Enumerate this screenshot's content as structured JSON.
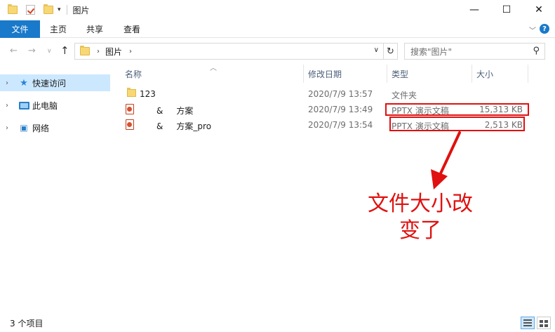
{
  "window": {
    "title": "图片",
    "controls": {
      "minimize": "—",
      "maximize": "☐",
      "close": "✕"
    }
  },
  "ribbon": {
    "tabs": [
      "文件",
      "主页",
      "共享",
      "查看"
    ],
    "help": "?"
  },
  "navigation": {
    "breadcrumb": [
      "图片"
    ],
    "search_placeholder": "搜索\"图片\""
  },
  "sidebar": {
    "items": [
      {
        "label": "快速访问",
        "icon": "star-icon",
        "selected": true
      },
      {
        "label": "此电脑",
        "icon": "computer-icon",
        "selected": false
      },
      {
        "label": "网络",
        "icon": "network-icon",
        "selected": false
      }
    ]
  },
  "columns": [
    "名称",
    "修改日期",
    "类型",
    "大小"
  ],
  "files": [
    {
      "name": "123",
      "modified": "2020/7/9 13:57",
      "type": "文件夹",
      "size": "",
      "icon": "folder-icon"
    },
    {
      "name": "&     方案",
      "modified": "2020/7/9 13:49",
      "type": "PPTX 演示文稿",
      "size": "15,313 KB",
      "icon": "pptx-icon"
    },
    {
      "name": "&     方案_pro",
      "modified": "2020/7/9 13:54",
      "type": "PPTX 演示文稿",
      "size": "2,513 KB",
      "icon": "pptx-icon"
    }
  ],
  "annotation": {
    "line1": "文件大小改",
    "line2": "变了",
    "color": "#e01010"
  },
  "status": {
    "item_count": "3 个项目"
  },
  "colors": {
    "accent": "#1979ca",
    "selection": "#cce8ff",
    "highlight": "#e01010"
  }
}
